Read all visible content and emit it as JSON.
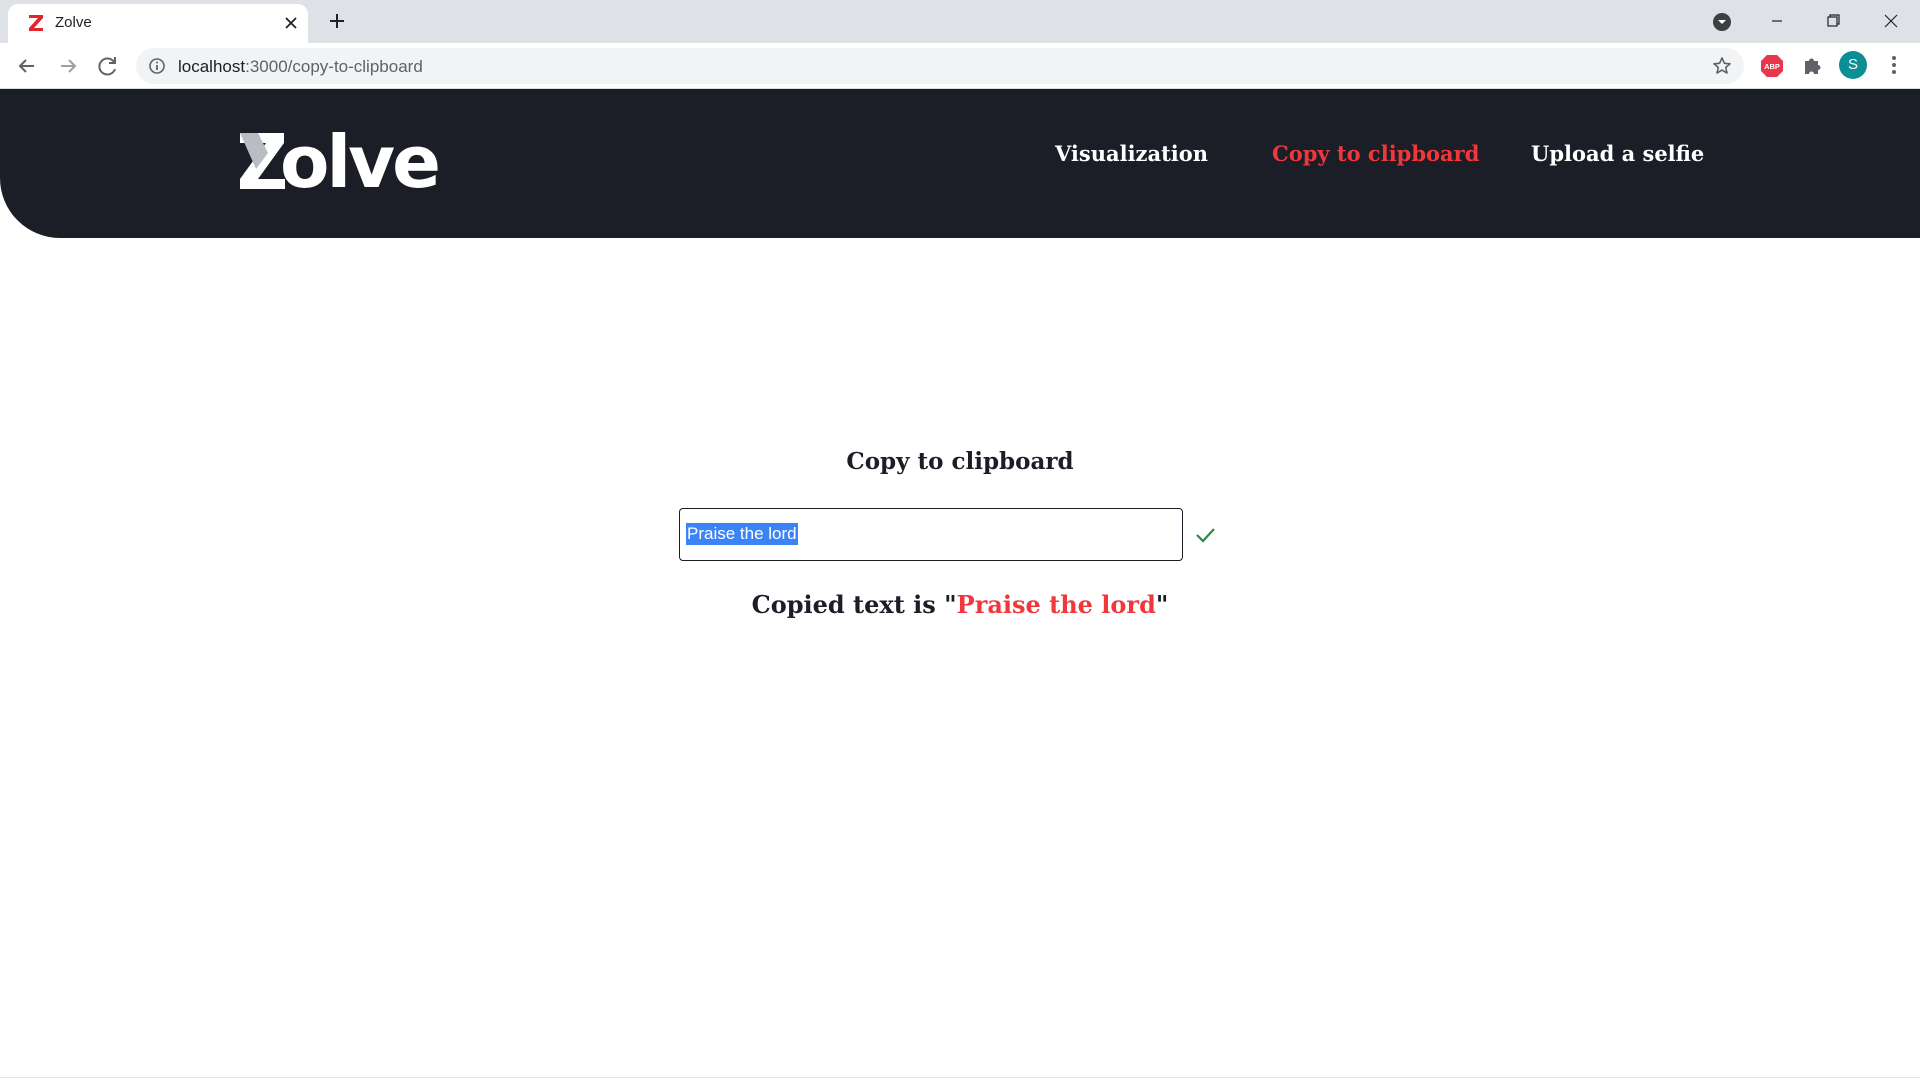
{
  "browser": {
    "tab_title": "Zolve",
    "url_host": "localhost",
    "url_path": ":3000/copy-to-clipboard",
    "profile_initial": "S"
  },
  "header": {
    "brand": "olve",
    "nav": [
      {
        "label": "Visualization",
        "active": false
      },
      {
        "label": "Copy to clipboard",
        "active": true
      },
      {
        "label": "Upload a selfie",
        "active": false
      }
    ],
    "background": "#1b1e26",
    "accent": "#f0373c"
  },
  "main": {
    "title": "Copy to clipboard",
    "input_value": "Praise the lord",
    "status_prefix": "Copied text is \"",
    "status_value": "Praise the lord",
    "status_suffix": "\"",
    "check_color": "#2e8b3e"
  },
  "icons": {
    "tab_favicon": "zolve-logo-icon",
    "tab_close": "close-icon",
    "new_tab": "plus-icon",
    "back": "arrow-left-icon",
    "forward": "arrow-right-icon",
    "reload": "reload-icon",
    "info": "info-icon",
    "bookmark": "star-icon",
    "adblock": "adblock-icon",
    "extensions": "puzzle-icon",
    "menu": "kebab-menu-icon",
    "copied": "checkmark-icon"
  }
}
